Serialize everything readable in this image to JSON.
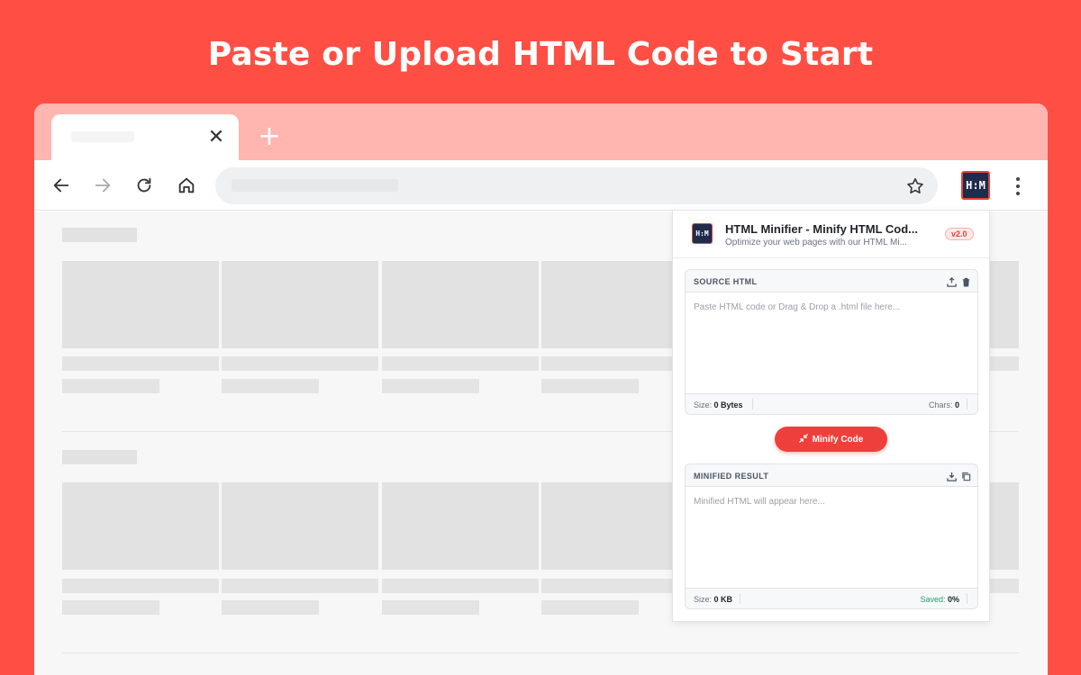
{
  "headline": "Paste or Upload HTML Code to Start",
  "browser": {
    "new_tab_symbol": "+",
    "close_symbol": "✕",
    "icons": [
      "back-arrow-icon",
      "forward-arrow-icon",
      "reload-icon",
      "home-icon",
      "bookmark-star-icon",
      "extension-icon",
      "kebab-menu-icon"
    ]
  },
  "extension": {
    "logo_text": "H:M",
    "title": "HTML Minifier - Minify HTML Cod...",
    "subtitle": "Optimize your web pages with our HTML Mi...",
    "version": "v2.0",
    "source": {
      "label": "SOURCE HTML",
      "placeholder": "Paste HTML code or Drag & Drop a .html file here...",
      "size_label": "Size:",
      "size_value": "0 Bytes",
      "chars_label": "Chars:",
      "chars_value": "0"
    },
    "minify_button": "Minify Code",
    "result": {
      "label": "MINIFIED RESULT",
      "placeholder": "Minified HTML will appear here...",
      "size_label": "Size:",
      "size_value": "0 KB",
      "saved_label": "Saved:",
      "saved_value": "0%"
    }
  },
  "colors": {
    "background": "#ff4f44",
    "tabstrip": "#ffb6b1",
    "accent": "#ef3f3a",
    "saved_green": "#22a06b"
  }
}
